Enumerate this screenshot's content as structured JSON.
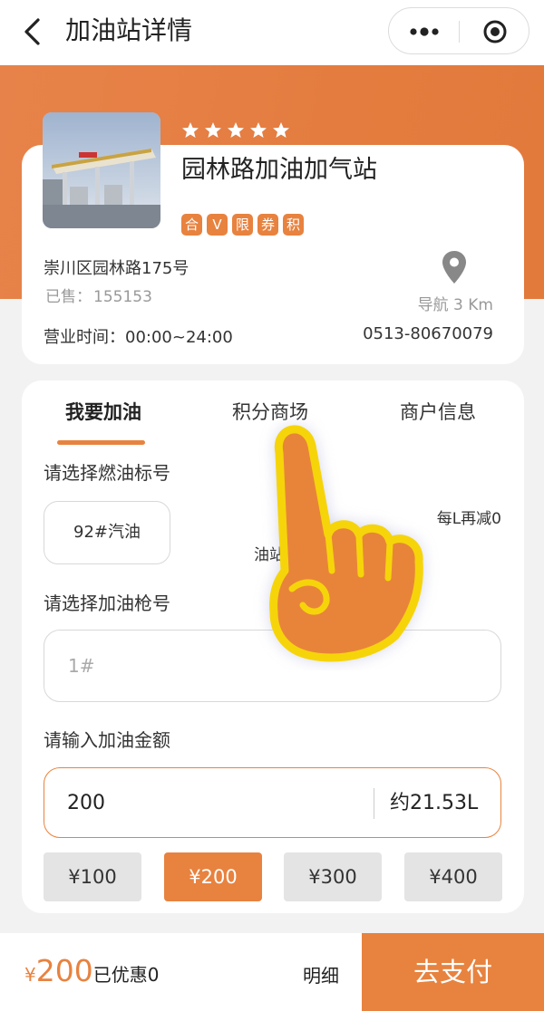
{
  "navbar": {
    "title": "加油站详情",
    "back_icon": "chevron-left-icon",
    "more_icon": "more-dots-icon",
    "target_icon": "target-icon"
  },
  "station": {
    "rating_stars": 5,
    "name": "园林路加油加气站",
    "tags": [
      "合",
      "V",
      "限",
      "券",
      "积"
    ],
    "address": "崇川区园林路175号",
    "sold_label": "已售：",
    "sold_count": "155153",
    "navigate_label": "导航 3 Km",
    "hours": "营业时间：00:00~24:00",
    "phone": "0513-80670079"
  },
  "tabs": [
    {
      "label": "我要加油",
      "active": true
    },
    {
      "label": "积分商场",
      "active": false
    },
    {
      "label": "商户信息",
      "active": false
    }
  ],
  "form": {
    "fuel_label": "请选择燃油标号",
    "fuel_option": "92#汽油",
    "discount_text": "每L再减0",
    "price_label": "油站",
    "gun_label": "请选择加油枪号",
    "gun_value": "1#",
    "amount_label": "请输入加油金额",
    "amount_value": "200",
    "litres_estimate": "约21.53L",
    "presets": [
      "¥100",
      "¥200",
      "¥300",
      "¥400"
    ],
    "preset_selected": "¥200"
  },
  "bottom": {
    "currency": "¥",
    "total": "200",
    "discount_text": "已优惠0",
    "detail_label": "明细",
    "pay_label": "去支付"
  },
  "colors": {
    "accent": "#e7833f",
    "hand_fill": "#e8843a",
    "hand_outline": "#f6d40a"
  }
}
